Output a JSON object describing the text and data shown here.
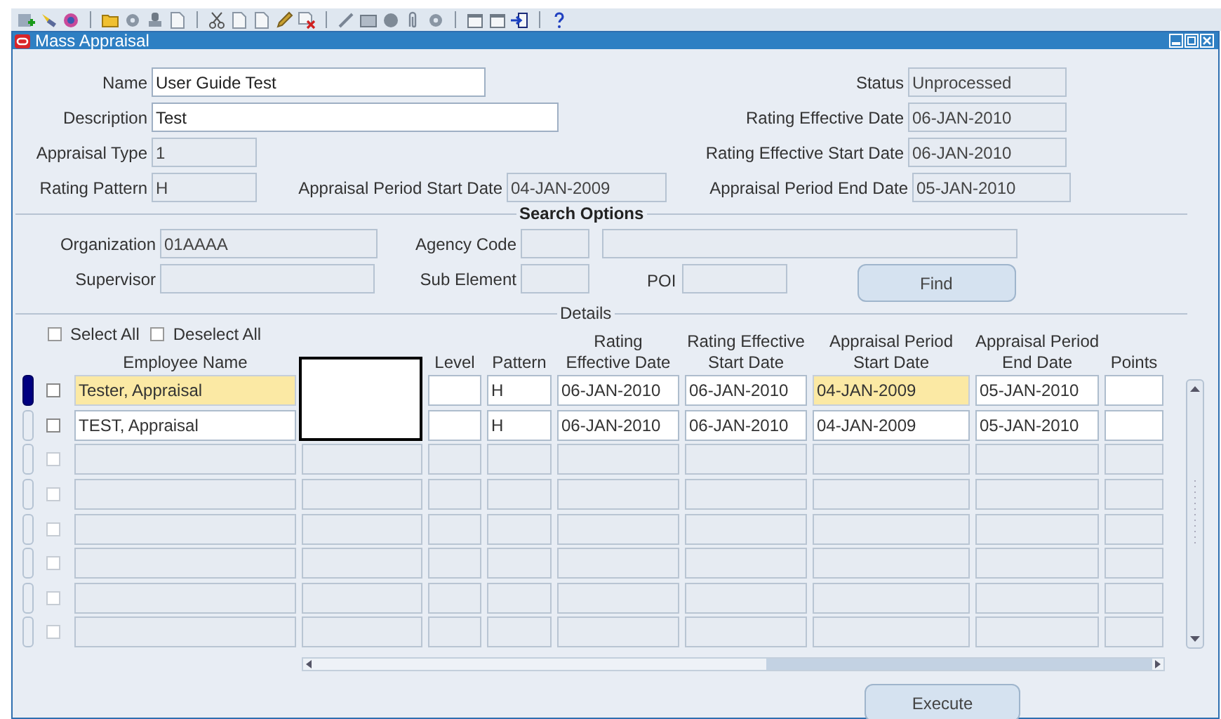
{
  "window": {
    "title": "Mass Appraisal"
  },
  "header": {
    "name": {
      "label": "Name",
      "value": "User Guide Test",
      "disabled": false
    },
    "status": {
      "label": "Status",
      "value": "Unprocessed",
      "disabled": true
    },
    "description": {
      "label": "Description",
      "value": "Test",
      "disabled": false
    },
    "rating_effective_date": {
      "label": "Rating Effective Date",
      "value": "06-JAN-2010",
      "disabled": true
    },
    "appraisal_type": {
      "label": "Appraisal Type",
      "value": "1",
      "disabled": true
    },
    "rating_effective_start_date": {
      "label": "Rating Effective Start Date",
      "value": "06-JAN-2010",
      "disabled": true
    },
    "rating_pattern": {
      "label": "Rating Pattern",
      "value": "H",
      "disabled": true
    },
    "appraisal_period_start_date": {
      "label": "Appraisal Period Start Date",
      "value": "04-JAN-2009",
      "disabled": true
    },
    "appraisal_period_end_date": {
      "label": "Appraisal Period End Date",
      "value": "05-JAN-2010",
      "disabled": true
    }
  },
  "search_options": {
    "title": "Search Options",
    "organization": {
      "label": "Organization",
      "value": "01AAAA",
      "disabled": true
    },
    "agency_code": {
      "label": "Agency Code",
      "disabled": true
    },
    "agency_name": {
      "disabled": true
    },
    "supervisor": {
      "label": "Supervisor",
      "disabled": true
    },
    "sub_element": {
      "label": "Sub Element",
      "disabled": true
    },
    "poi": {
      "label": "POI",
      "disabled": true
    },
    "find_button": "Find"
  },
  "details": {
    "title": "Details",
    "select_all": {
      "label": "Select All",
      "checked": false
    },
    "deselect_all": {
      "label": "Deselect All",
      "checked": false
    },
    "columns": [
      {
        "label": "Employee Name"
      },
      {
        "covered": true,
        "kind": "redacted"
      },
      {
        "label": "Level"
      },
      {
        "label": "Pattern"
      },
      {
        "label": "Rating\nEffective Date"
      },
      {
        "label": "Rating Effective\nStart Date"
      },
      {
        "label": "Appraisal Period\nStart Date"
      },
      {
        "label": "Appraisal Period\nEnd Date"
      },
      {
        "label": "Points"
      }
    ],
    "rows": [
      {
        "selected": true,
        "checked": false,
        "disabled": false,
        "cells": [
          {
            "text": "Tester, Appraisal",
            "highlighted": true
          },
          {
            "covered": true
          },
          {
            "highlighted": false
          },
          {
            "text": "H",
            "highlighted": false
          },
          {
            "text": "06-JAN-2010",
            "highlighted": false
          },
          {
            "text": "06-JAN-2010",
            "highlighted": false
          },
          {
            "text": "04-JAN-2009",
            "highlighted": true
          },
          {
            "text": "05-JAN-2010",
            "highlighted": false
          },
          {
            "highlighted": false
          }
        ]
      },
      {
        "selected": false,
        "checked": false,
        "disabled": false,
        "cells": [
          {
            "text": "TEST, Appraisal",
            "highlighted": false
          },
          {
            "covered": true
          },
          {
            "highlighted": false
          },
          {
            "text": "H",
            "highlighted": false
          },
          {
            "text": "06-JAN-2010",
            "highlighted": false
          },
          {
            "text": "06-JAN-2010",
            "highlighted": false
          },
          {
            "text": "04-JAN-2009",
            "highlighted": false
          },
          {
            "text": "05-JAN-2010",
            "highlighted": false
          },
          {
            "highlighted": false
          }
        ]
      },
      {
        "selected": false,
        "checked": false,
        "disabled": true
      },
      {
        "selected": false,
        "checked": false,
        "disabled": true
      },
      {
        "selected": false,
        "checked": false,
        "disabled": true
      },
      {
        "selected": false,
        "checked": false,
        "disabled": true
      },
      {
        "selected": false,
        "checked": false,
        "disabled": true
      },
      {
        "selected": false,
        "checked": false,
        "disabled": true
      }
    ]
  },
  "execute_button": "Execute"
}
